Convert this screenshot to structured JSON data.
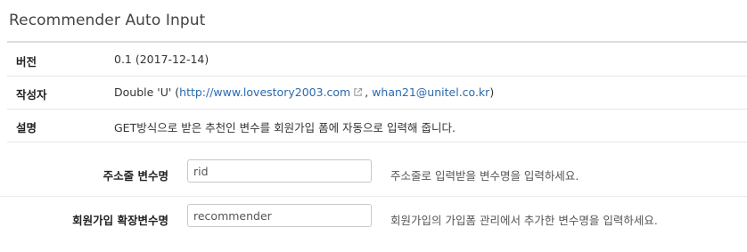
{
  "page": {
    "title": "Recommender Auto Input"
  },
  "info": {
    "version_label": "버전",
    "version_value": "0.1 (2017-12-14)",
    "author_label": "작성자",
    "author_name": "Double 'U' (",
    "author_url": "http://www.lovestory2003.com",
    "author_sep": ", ",
    "author_email": "whan21@unitel.co.kr",
    "author_close": ")",
    "desc_label": "설명",
    "desc_value": "GET방식으로 받은 추천인 변수를 회원가입 폼에 자동으로 입력해 줍니다."
  },
  "form": {
    "fields": [
      {
        "label": "주소줄 변수명",
        "value": "rid",
        "help": "주소줄로 입력받을 변수명을 입력하세요."
      },
      {
        "label": "회원가입 확장변수명",
        "value": "recommender",
        "help": "회원가입의 가입폼 관리에서 추가한 변수명을 입력하세요."
      }
    ]
  },
  "icons": {
    "external_link": "external-link-icon"
  },
  "colors": {
    "link": "#2a6ab0",
    "rule": "#dcdcdc"
  }
}
